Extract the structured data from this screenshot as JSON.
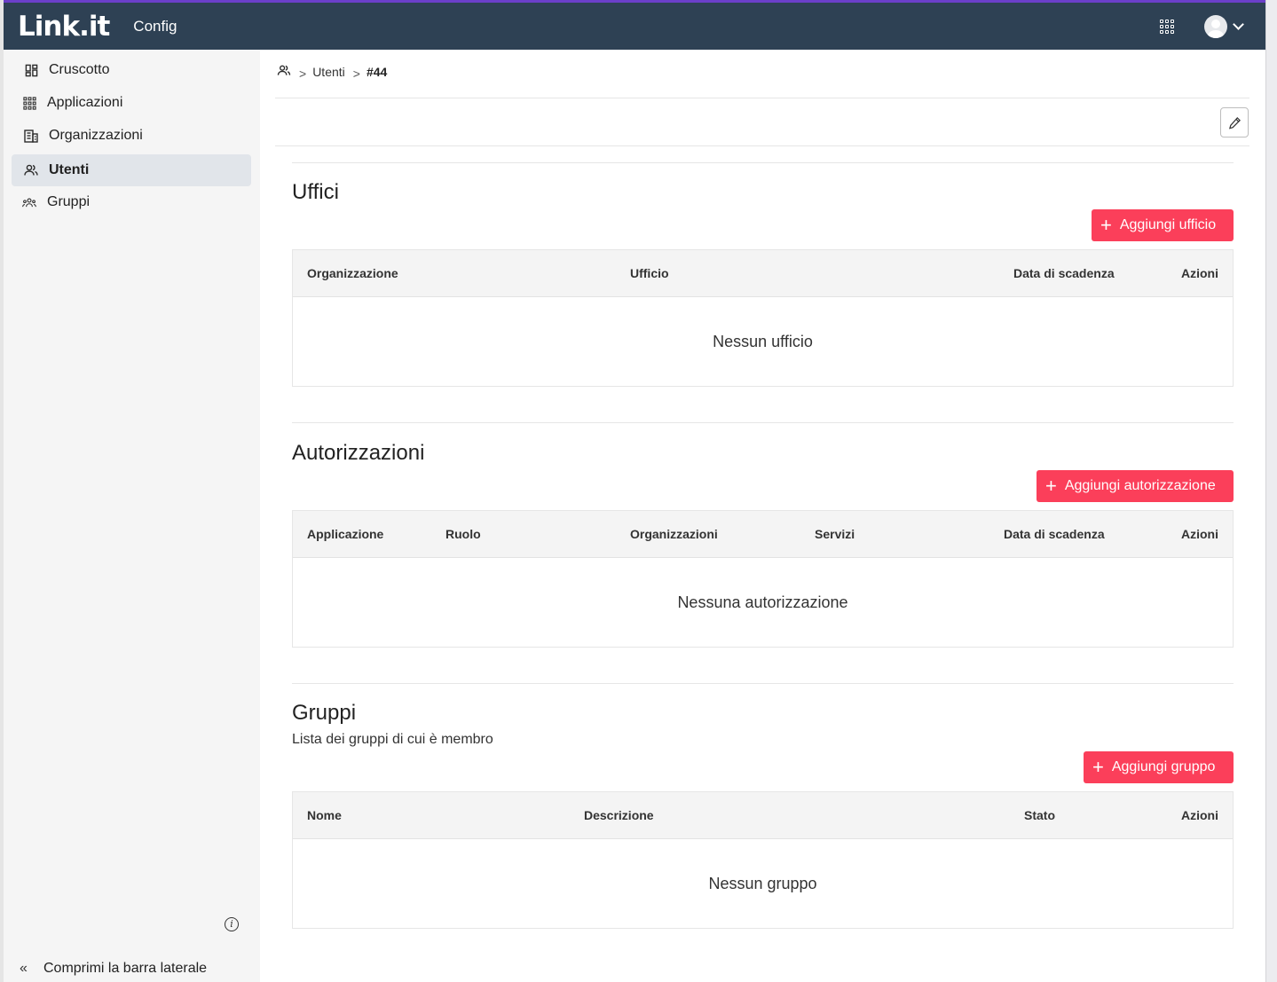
{
  "topbar": {
    "logo": "Link.it",
    "app_name": "Config",
    "apps_icon": "apps-grid-icon",
    "avatar_icon": "user-avatar-icon"
  },
  "sidebar": {
    "items": [
      {
        "label": "Cruscotto",
        "icon": "dashboard-icon"
      },
      {
        "label": "Applicazioni",
        "icon": "apps-icon"
      },
      {
        "label": "Organizzazioni",
        "icon": "building-icon"
      },
      {
        "label": "Utenti",
        "icon": "users-icon",
        "active": true
      },
      {
        "label": "Gruppi",
        "icon": "groups-icon"
      }
    ],
    "info_glyph": "i",
    "collapse_glyph": "«",
    "collapse_label": "Comprimi la barra laterale"
  },
  "breadcrumb": {
    "sep": ">",
    "item1": "Utenti",
    "current": "#44"
  },
  "uffici": {
    "title": "Uffici",
    "add_label": "Aggiungi ufficio",
    "columns": [
      "Organizzazione",
      "Ufficio",
      "Data di scadenza",
      "Azioni"
    ],
    "empty": "Nessun ufficio"
  },
  "autorizzazioni": {
    "title": "Autorizzazioni",
    "add_label": "Aggiungi autorizzazione",
    "columns": [
      "Applicazione",
      "Ruolo",
      "Organizzazioni",
      "Servizi",
      "Data di scadenza",
      "Azioni"
    ],
    "empty": "Nessuna autorizzazione"
  },
  "gruppi": {
    "title": "Gruppi",
    "subtitle": "Lista dei gruppi di cui è membro",
    "add_label": "Aggiungi gruppo",
    "columns": [
      "Nome",
      "Descrizione",
      "Stato",
      "Azioni"
    ],
    "empty": "Nessun gruppo"
  },
  "colors": {
    "topbar": "#2e4154",
    "accent": "#fb3f5a",
    "sidebar": "#f5f5f5",
    "active_item": "#e1e5ea"
  }
}
